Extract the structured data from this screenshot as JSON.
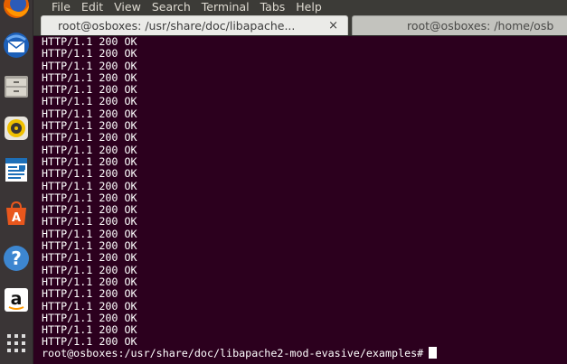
{
  "menubar": {
    "items": [
      "File",
      "Edit",
      "View",
      "Search",
      "Terminal",
      "Tabs",
      "Help"
    ]
  },
  "tabs": [
    {
      "title": "root@osboxes: /usr/share/doc/libapache...",
      "close": "×",
      "active": true
    },
    {
      "title": "root@osboxes: /home/osb",
      "active": false
    }
  ],
  "launcher": {
    "icons": [
      "firefox-icon",
      "thunderbird-icon",
      "files-icon",
      "rhythmbox-icon",
      "writer-icon",
      "software-center-icon",
      "help-icon",
      "amazon-icon",
      "show-apps-icon"
    ]
  },
  "terminal": {
    "lines": [
      "HTTP/1.1 200 OK",
      "HTTP/1.1 200 OK",
      "HTTP/1.1 200 OK",
      "HTTP/1.1 200 OK",
      "HTTP/1.1 200 OK",
      "HTTP/1.1 200 OK",
      "HTTP/1.1 200 OK",
      "HTTP/1.1 200 OK",
      "HTTP/1.1 200 OK",
      "HTTP/1.1 200 OK",
      "HTTP/1.1 200 OK",
      "HTTP/1.1 200 OK",
      "HTTP/1.1 200 OK",
      "HTTP/1.1 200 OK",
      "HTTP/1.1 200 OK",
      "HTTP/1.1 200 OK",
      "HTTP/1.1 200 OK",
      "HTTP/1.1 200 OK",
      "HTTP/1.1 200 OK",
      "HTTP/1.1 200 OK",
      "HTTP/1.1 200 OK",
      "HTTP/1.1 200 OK",
      "HTTP/1.1 200 OK",
      "HTTP/1.1 200 OK",
      "HTTP/1.1 200 OK",
      "HTTP/1.1 200 OK"
    ],
    "prompt": "root@osboxes:/usr/share/doc/libapache2-mod-evasive/examples#"
  },
  "colors": {
    "terminal_bg": "#2c001e",
    "launcher_bg": "#3a3536",
    "menubar_bg": "#3c3b37"
  }
}
